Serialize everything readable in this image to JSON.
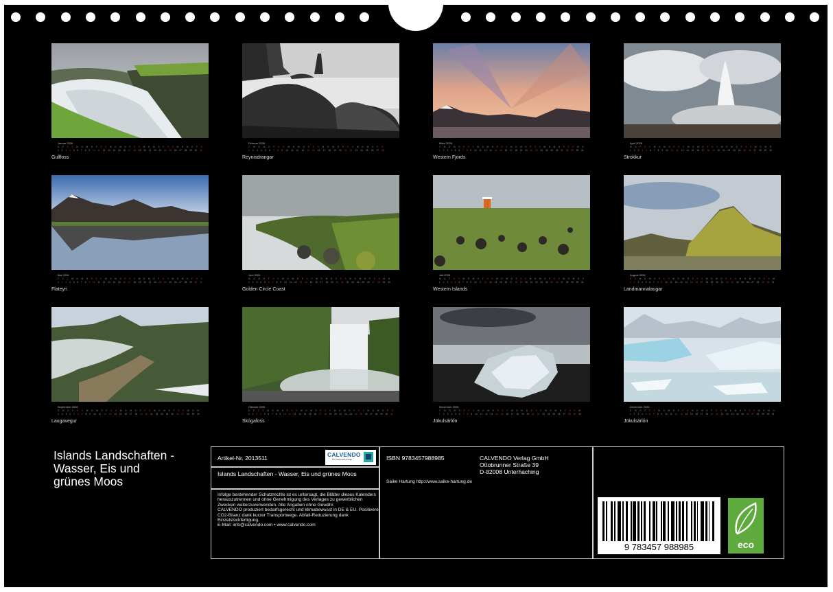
{
  "months": [
    {
      "key": "jan",
      "name": "Januar 2026",
      "caption": "Gullfoss",
      "start": 3,
      "length": 31
    },
    {
      "key": "feb",
      "name": "Februar 2026",
      "caption": "Reynisdrangar",
      "start": 6,
      "length": 28
    },
    {
      "key": "mar",
      "name": "März 2026",
      "caption": "Western Fjords",
      "start": 6,
      "length": 31
    },
    {
      "key": "apr",
      "name": "April 2026",
      "caption": "Strokkur",
      "start": 2,
      "length": 30
    },
    {
      "key": "may",
      "name": "Mai 2026",
      "caption": "Flateyri",
      "start": 4,
      "length": 31
    },
    {
      "key": "jun",
      "name": "Juni 2026",
      "caption": "Golden Circle Coast",
      "start": 0,
      "length": 30
    },
    {
      "key": "jul",
      "name": "Juli 2026",
      "caption": "Western Islands",
      "start": 2,
      "length": 31
    },
    {
      "key": "aug",
      "name": "August 2026",
      "caption": "Landmannalaugar",
      "start": 5,
      "length": 31
    },
    {
      "key": "sep",
      "name": "September 2026",
      "caption": "Laugavegur",
      "start": 1,
      "length": 30
    },
    {
      "key": "oct",
      "name": "Oktober 2026",
      "caption": "Skógafoss",
      "start": 3,
      "length": 31
    },
    {
      "key": "nov",
      "name": "November 2026",
      "caption": "Jökulsárlón",
      "start": 6,
      "length": 30
    },
    {
      "key": "dec",
      "name": "Dezember 2026",
      "caption": "Jökulsárlón",
      "start": 1,
      "length": 31
    }
  ],
  "weekday_initials": [
    "M",
    "D",
    "M",
    "D",
    "F",
    "S",
    "S"
  ],
  "cover": {
    "title": "Islands Landschaften -\n Wasser, Eis und\ngrünes Moos"
  },
  "info": {
    "article_no": "Artikel-Nr. 2013511",
    "logo_main": "CALVENDO",
    "logo_sub": "Ihr Kalenderverlag",
    "product_title": "Islands Landschaften - Wasser, Eis und grünes Moos",
    "legal": "Infolge bestehender Schutzrechte ist es untersagt, die Blätter dieses Kalenders herauszutrennen und ohne Genehmigung des Verlages zu gewerblichen Zwecken weiterzuverwenden. Alle Angaben ohne Gewähr.\nCALVENDO produziert bedarfsgerecht und klimabewusst in DE & EU. Positivere CO2-Bilanz dank kurzer Transportwege. Abfall-Reduzierung dank Einzelstückfertigung.\nE-Mail: info@calvendo.com • www.calvendo.com",
    "isbn": "ISBN 9783457988985",
    "publisher": "CALVENDO Verlag GmbH\nOttobrunner Straße 39\nD-82008 Unterhaching",
    "photographer": "Saike Hartung http://www.salke-hartung.de",
    "barcode_digits": "9 783457 988985",
    "eco_label": "eco"
  }
}
